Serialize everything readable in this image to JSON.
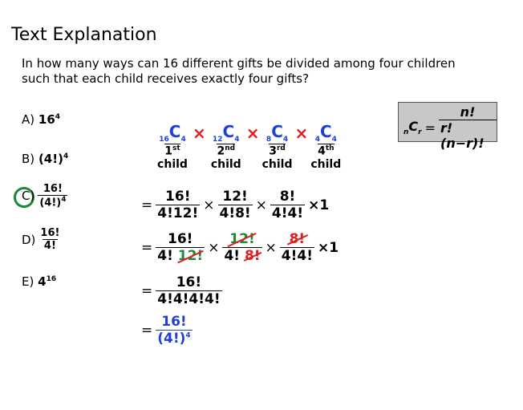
{
  "header": {
    "title": "Text Explanation"
  },
  "question": {
    "text": "In how many ways can 16 different gifts be divided among four children such that each child receives exactly four gifts?"
  },
  "options": [
    {
      "letter": "A)",
      "base": "16",
      "exp": "4"
    },
    {
      "letter": "B)",
      "base": "(4!)",
      "exp": "4"
    },
    {
      "letter": "C)",
      "num": "16!",
      "den": "(4!)",
      "den_exp": "4"
    },
    {
      "letter": "D)",
      "num": "16!",
      "den": "4!"
    },
    {
      "letter": "E)",
      "base": "4",
      "exp": "16"
    }
  ],
  "combos": [
    {
      "pre": "16",
      "sym": "C",
      "post": "4",
      "ord": "1",
      "ord_suffix": "st",
      "child": "child"
    },
    {
      "pre": "12",
      "sym": "C",
      "post": "4",
      "ord": "2",
      "ord_suffix": "nd",
      "child": "child"
    },
    {
      "pre": "8",
      "sym": "C",
      "post": "4",
      "ord": "3",
      "ord_suffix": "rd",
      "child": "child"
    },
    {
      "pre": "4",
      "sym": "C",
      "post": "4",
      "ord": "4",
      "ord_suffix": "th",
      "child": "child"
    }
  ],
  "times_symbol": "×",
  "equals": "=",
  "step1": [
    {
      "num": "16!",
      "den": "4!12!"
    },
    {
      "num": "12!",
      "den": "4!8!"
    },
    {
      "num": "8!",
      "den": "4!4!"
    }
  ],
  "step1_tail": "×1",
  "step2": {
    "f1_num": "16!",
    "f1_den_a": "4!",
    "f1_den_b": "12!",
    "f2_num": "12!",
    "f2_den_a": "4!",
    "f2_den_b": "8!",
    "f3_num": "8!",
    "f3_den": "4!4!",
    "tail": "×1"
  },
  "step3": {
    "num": "16!",
    "den": "4!4!4!4!"
  },
  "step4": {
    "num": "16!",
    "den": "(4!)",
    "den_exp": "4"
  },
  "formula": {
    "pre": "n",
    "sym": "C",
    "post": "r",
    "eq": "=",
    "num": "n!",
    "den": "r!(n−r)!"
  },
  "colors": {
    "blue": "#1f3fd6",
    "red": "#e02020",
    "green": "#1a8a3a",
    "box": "#c8c8c8"
  }
}
